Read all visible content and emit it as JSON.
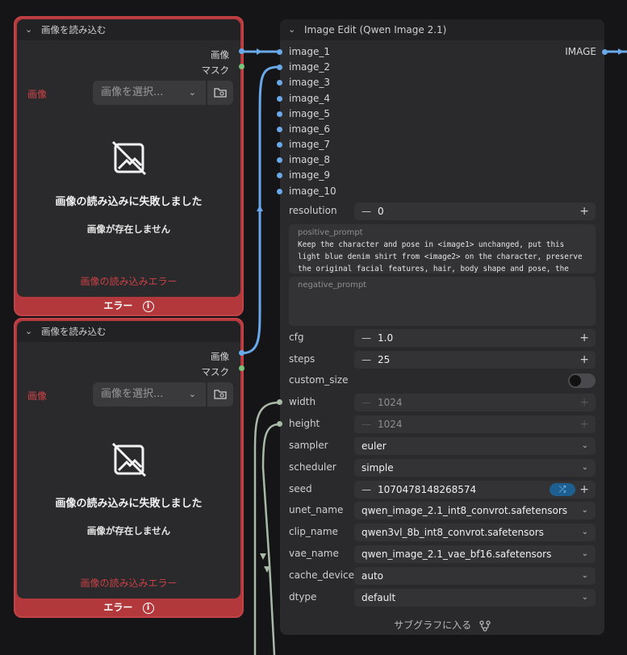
{
  "colors": {
    "image_link": "#6aa9e9",
    "int_link": "#a9b9a7",
    "mask_socket": "#79c37a",
    "error_node": "#b2383b",
    "error_text": "#d24347"
  },
  "load_nodes": [
    {
      "title": "画像を読み込む",
      "out_image": "画像",
      "out_mask": "マスク",
      "field_label": "画像",
      "select_placeholder": "画像を選択...",
      "icon": "no-image-icon",
      "error_title": "画像の読み込みに失敗しました",
      "error_detail": "画像が存在しません",
      "error_status": "画像の読み込みエラー",
      "footer": "エラー"
    },
    {
      "title": "画像を読み込む",
      "out_image": "画像",
      "out_mask": "マスク",
      "field_label": "画像",
      "select_placeholder": "画像を選択...",
      "icon": "no-image-icon",
      "error_title": "画像の読み込みに失敗しました",
      "error_detail": "画像が存在しません",
      "error_status": "画像の読み込みエラー",
      "footer": "エラー"
    }
  ],
  "main_node": {
    "title": "Image Edit (Qwen Image 2.1)",
    "output": "IMAGE",
    "inputs": [
      "image_1",
      "image_2",
      "image_3",
      "image_4",
      "image_5",
      "image_6",
      "image_7",
      "image_8",
      "image_9",
      "image_10"
    ],
    "resolution": {
      "label": "resolution",
      "value": "0"
    },
    "positive_prompt": {
      "label": "positive_prompt",
      "text": "Keep the character and pose in <image1> unchanged, put this light blue denim shirt from <image2> on the character, preserve the original facial features, hair, body shape and pose, the"
    },
    "negative_prompt": {
      "label": "negative_prompt",
      "text": ""
    },
    "cfg": {
      "label": "cfg",
      "value": "1.0"
    },
    "steps": {
      "label": "steps",
      "value": "25"
    },
    "custom_size": {
      "label": "custom_size",
      "enabled": false
    },
    "width": {
      "label": "width",
      "value": "1024"
    },
    "height": {
      "label": "height",
      "value": "1024"
    },
    "sampler": {
      "label": "sampler",
      "value": "euler"
    },
    "scheduler": {
      "label": "scheduler",
      "value": "simple"
    },
    "seed": {
      "label": "seed",
      "value": "1070478148268574",
      "icon": "shuffle-icon"
    },
    "unet_name": {
      "label": "unet_name",
      "value": "qwen_image_2.1_int8_convrot.safetensors"
    },
    "clip_name": {
      "label": "clip_name",
      "value": "qwen3vl_8b_int8_convrot.safetensors"
    },
    "vae_name": {
      "label": "vae_name",
      "value": "qwen_image_2.1_vae_bf16.safetensors"
    },
    "cache_device": {
      "label": "cache_device",
      "value": "auto"
    },
    "dtype": {
      "label": "dtype",
      "value": "default"
    },
    "footer": "サブグラフに入る"
  }
}
